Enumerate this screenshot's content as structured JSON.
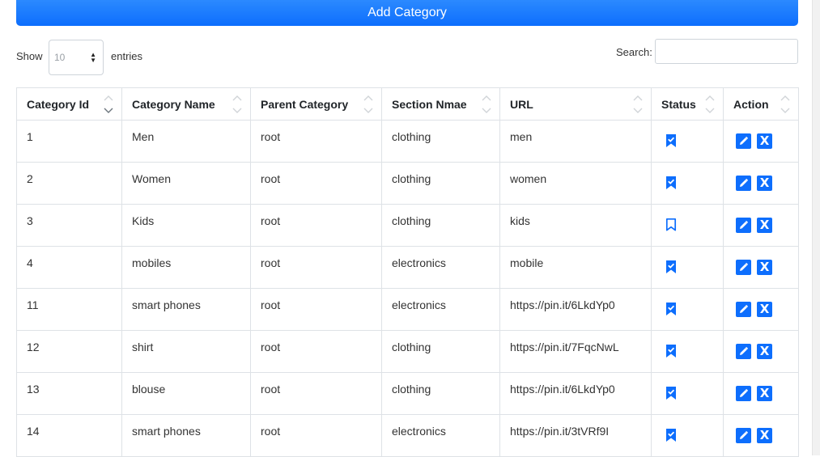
{
  "header": {
    "add_button_label": "Add Category"
  },
  "controls": {
    "show_label": "Show",
    "entries_value": "10",
    "entries_label": "entries",
    "search_label": "Search:",
    "search_value": ""
  },
  "table": {
    "columns": [
      "Category Id",
      "Category Name",
      "Parent Category",
      "Section Nmae",
      "URL",
      "Status",
      "Action"
    ],
    "rows": [
      {
        "id": "1",
        "name": "Men",
        "parent": "root",
        "section": "clothing",
        "url": "men",
        "status": "active"
      },
      {
        "id": "2",
        "name": "Women",
        "parent": "root",
        "section": "clothing",
        "url": "women",
        "status": "active"
      },
      {
        "id": "3",
        "name": "Kids",
        "parent": "root",
        "section": "clothing",
        "url": "kids",
        "status": "inactive"
      },
      {
        "id": "4",
        "name": "mobiles",
        "parent": "root",
        "section": "electronics",
        "url": "mobile",
        "status": "active"
      },
      {
        "id": "11",
        "name": "smart phones",
        "parent": "root",
        "section": "electronics",
        "url": "https://pin.it/6LkdYp0",
        "status": "active"
      },
      {
        "id": "12",
        "name": "shirt",
        "parent": "root",
        "section": "clothing",
        "url": "https://pin.it/7FqcNwL",
        "status": "active"
      },
      {
        "id": "13",
        "name": "blouse",
        "parent": "root",
        "section": "clothing",
        "url": "https://pin.it/6LkdYp0",
        "status": "active"
      },
      {
        "id": "14",
        "name": "smart phones",
        "parent": "root",
        "section": "electronics",
        "url": "https://pin.it/3tVRf9I",
        "status": "active"
      }
    ]
  },
  "icons": {
    "status_active": "bookmark-check-fill-icon",
    "status_inactive": "bookmark-outline-icon",
    "edit": "pencil-square-icon",
    "delete": "x-square-icon"
  },
  "colors": {
    "accent": "#0d6efd",
    "border": "#dee2e6"
  }
}
